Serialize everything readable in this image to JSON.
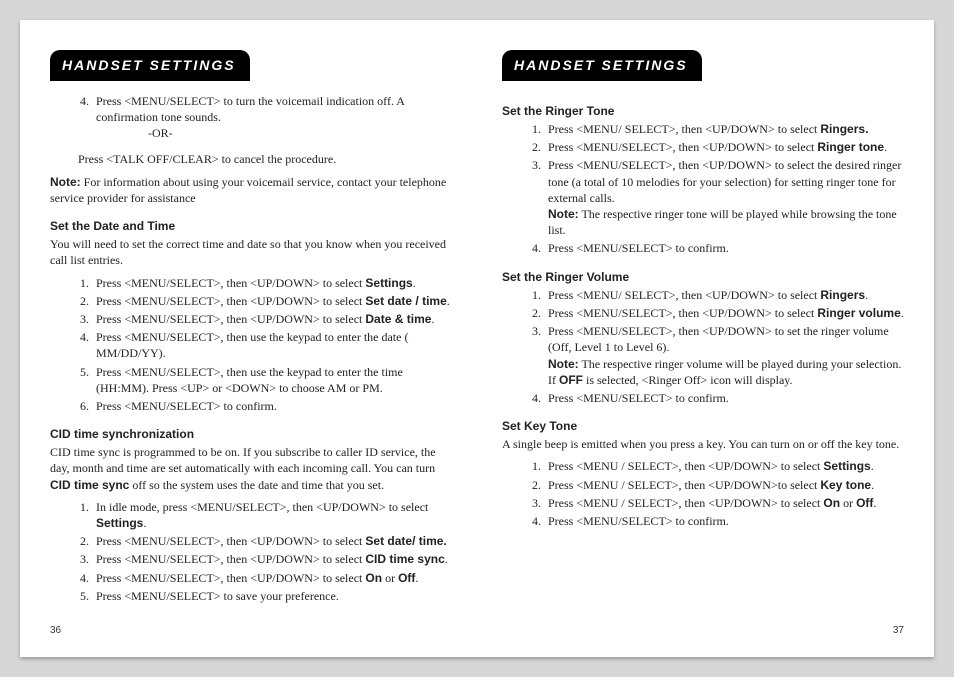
{
  "leftHeading": "HANDSET SETTINGS",
  "rightHeading": "HANDSET SETTINGS",
  "leftPageNum": "36",
  "rightPageNum": "37",
  "voicemail": {
    "step4": "Press <MENU/SELECT> to turn the voicemail indication off. A confirmation tone sounds.",
    "or": " -OR-",
    "cancel": "Press <TALK OFF/CLEAR> to cancel the procedure.",
    "noteLabel": "Note:",
    "noteText": " For information about using your voicemail service, contact your telephone service provider for assistance"
  },
  "dateTime": {
    "title": "Set the Date and Time",
    "intro": "You will need to set the correct time and date so that you know when you received call list entries.",
    "steps": [
      "Press <MENU/SELECT>, then <UP/DOWN> to select ",
      "Press <MENU/SELECT>, then <UP/DOWN> to select ",
      "Press <MENU/SELECT>, then <UP/DOWN> to select ",
      "Press <MENU/SELECT>, then use the keypad to enter the date ( MM/DD/YY).",
      "Press <MENU/SELECT>, then use the keypad to enter the time (HH:MM). Press <UP> or <DOWN> to choose AM or PM.",
      "Press <MENU/SELECT> to confirm."
    ],
    "bold": {
      "s1": "Settings",
      "s2": "Set date / time",
      "s3": "Date & time"
    }
  },
  "cidSync": {
    "title": "CID time synchronization",
    "introA": "CID time sync is programmed to be on. If you subscribe to caller ID service, the day, month and time are set automatically with each incoming call. You can turn ",
    "introBold": "CID time sync",
    "introB": " off so the system uses the date and time that you set.",
    "steps": {
      "s1a": "In idle mode, press <MENU/SELECT>, then <UP/DOWN> to select ",
      "s1b": "Settings",
      "s2a": "Press <MENU/SELECT>, then <UP/DOWN> to select ",
      "s2b": "Set date/ time.",
      "s3a": "Press <MENU/SELECT>, then <UP/DOWN> to select ",
      "s3b": "CID time sync",
      "s4a": "Press <MENU/SELECT>, then <UP/DOWN> to select ",
      "s4b": "On",
      "s4c": " or ",
      "s4d": "Off",
      "s5": "Press <MENU/SELECT> to save your preference."
    }
  },
  "ringerTone": {
    "title": "Set the Ringer Tone",
    "s1a": "Press <MENU/ SELECT>, then <UP/DOWN> to select ",
    "s1b": "Ringers.",
    "s2a": "Press <MENU/SELECT>, then <UP/DOWN> to select ",
    "s2b": "Ringer tone",
    "s3": "Press <MENU/SELECT>, then <UP/DOWN> to select the desired ringer tone (a total of 10 melodies for your selection) for setting ringer tone for external calls.",
    "noteLabel": "Note:",
    "noteText": " The respective ringer tone will be played while browsing the tone list.",
    "s4": "Press <MENU/SELECT> to confirm."
  },
  "ringerVol": {
    "title": "Set the Ringer Volume",
    "s1a": "Press <MENU/ SELECT>, then <UP/DOWN> to select ",
    "s1b": "Ringers",
    "s2a": "Press <MENU/SELECT>, then <UP/DOWN> to select ",
    "s2b": "Ringer volume",
    "s3": "Press <MENU/SELECT>, then <UP/DOWN> to set the ringer volume (Off, Level 1 to Level 6).",
    "noteLabel": "Note:",
    "noteTextA": " The respective ringer volume will be played during your selection. If ",
    "noteBold": "OFF",
    "noteTextB": " is selected, <Ringer Off> icon will display.",
    "s4": "Press <MENU/SELECT> to confirm."
  },
  "keyTone": {
    "title": "Set Key Tone",
    "intro": "A single beep is emitted when you press a key.  You can turn on or off the key tone.",
    "s1a": "Press <MENU / SELECT>, then <UP/DOWN> to select ",
    "s1b": "Settings",
    "s2a": "Press <MENU / SELECT>, then <UP/DOWN>to select ",
    "s2b": "Key tone",
    "s3a": "Press <MENU / SELECT>, then <UP/DOWN> to select ",
    "s3on": "On",
    "s3or": " or ",
    "s3off": "Off",
    "s4": "Press <MENU/SELECT> to confirm."
  }
}
